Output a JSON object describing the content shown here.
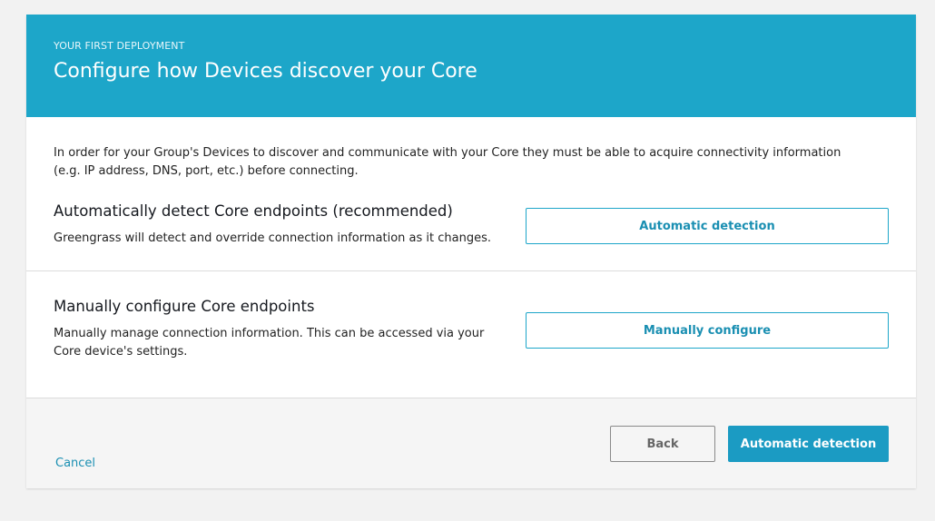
{
  "header": {
    "eyebrow": "YOUR FIRST DEPLOYMENT",
    "title": "Configure how Devices discover your Core"
  },
  "intro": {
    "text": "In order for your Group's Devices to discover and communicate with your Core they must be able to acquire connectivity information (e.g. IP address, DNS, port, etc.) before connecting."
  },
  "options": {
    "automatic": {
      "title": "Automatically detect Core endpoints (recommended)",
      "description": "Greengrass will detect and override connection information as it changes.",
      "button_label": "Automatic detection"
    },
    "manual": {
      "title": "Manually configure Core endpoints",
      "description": "Manually manage connection information. This can be accessed via your Core device's settings.",
      "button_label": "Manually configure"
    }
  },
  "footer": {
    "cancel_label": "Cancel",
    "back_label": "Back",
    "primary_label": "Automatic detection"
  },
  "colors": {
    "banner": "#1da6c9",
    "primary_button": "#1b9bc3",
    "link": "#1a8fb2",
    "page_background": "#f2f2f2",
    "footer_background": "#f5f5f5"
  }
}
